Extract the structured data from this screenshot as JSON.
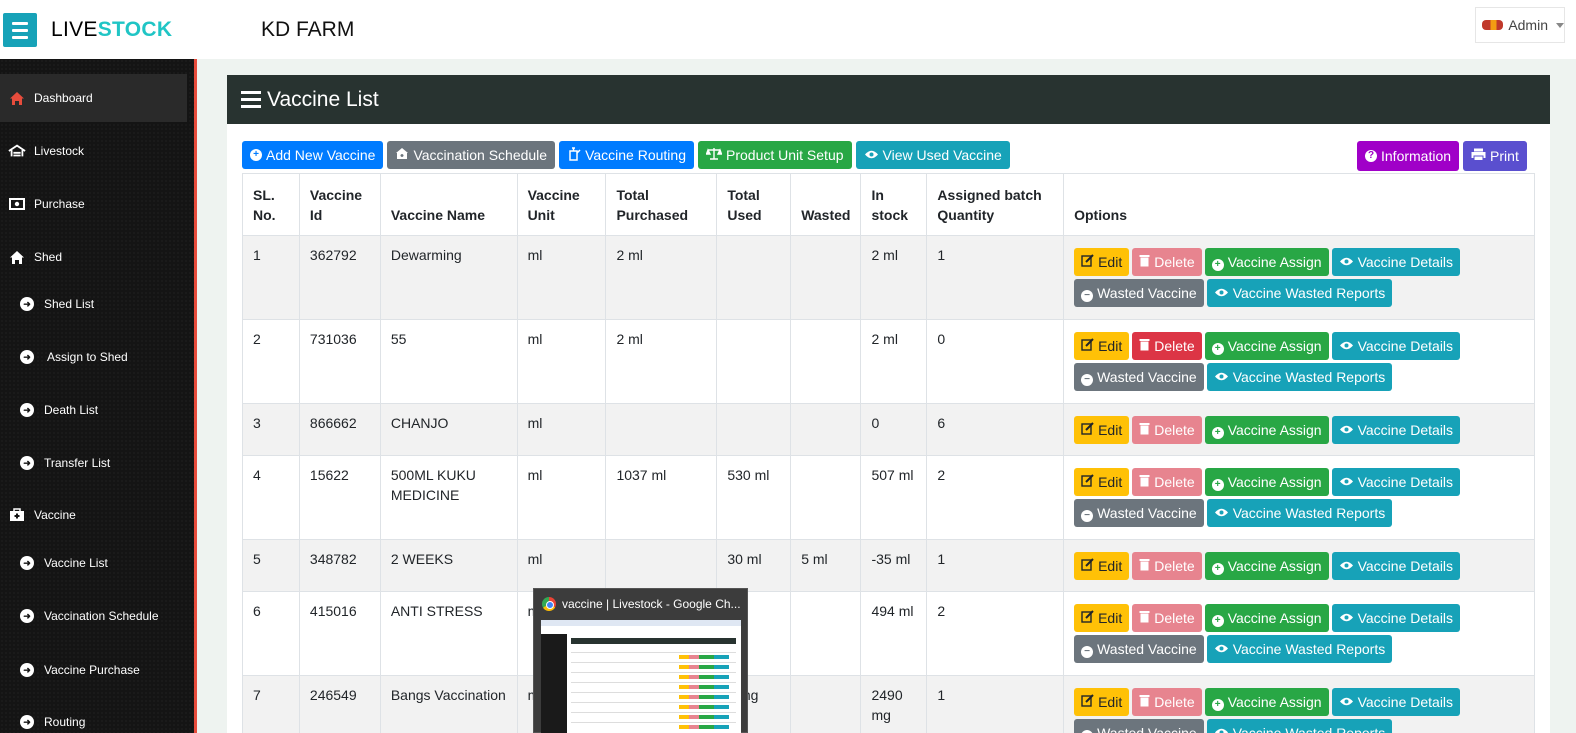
{
  "header": {
    "brand_part1": "LIVE",
    "brand_part2": "STOCK",
    "farm_name": "KD FARM",
    "user_label": "Admin"
  },
  "sidebar": {
    "items": [
      {
        "label": "Dashboard",
        "icon": "home-icon"
      },
      {
        "label": "Livestock",
        "icon": "livestock-icon"
      },
      {
        "label": "Purchase",
        "icon": "money-icon"
      },
      {
        "label": "Shed",
        "icon": "home-icon"
      },
      {
        "label": "Shed List",
        "icon": "arrow-circle-right-icon"
      },
      {
        "label": "Assign to Shed",
        "icon": "arrow-circle-right-icon"
      },
      {
        "label": "Death List",
        "icon": "arrow-circle-right-icon"
      },
      {
        "label": "Transfer List",
        "icon": "arrow-circle-right-icon"
      },
      {
        "label": "Vaccine",
        "icon": "medkit-icon"
      },
      {
        "label": "Vaccine List",
        "icon": "arrow-circle-right-icon"
      },
      {
        "label": "Vaccination Schedule",
        "icon": "arrow-circle-right-icon"
      },
      {
        "label": "Vaccine Purchase",
        "icon": "arrow-circle-right-icon"
      },
      {
        "label": "Routing",
        "icon": "arrow-circle-right-icon"
      }
    ]
  },
  "page": {
    "title": "Vaccine List"
  },
  "toolbar": {
    "add_new": "Add New Vaccine",
    "schedule": "Vaccination Schedule",
    "routing": "Vaccine Routing",
    "unit_setup": "Product Unit Setup",
    "view_used": "View Used Vaccine",
    "information": "Information",
    "print": "Print"
  },
  "table": {
    "headers": {
      "sl": "SL. No.",
      "vaccine_id": "Vaccine Id",
      "name": "Vaccine Name",
      "unit": "Vaccine Unit",
      "purchased": "Total Purchased",
      "used": "Total Used",
      "wasted": "Wasted",
      "stock": "In stock",
      "batch": "Assigned batch Quantity",
      "options": "Options"
    },
    "rows": [
      {
        "sl": "1",
        "id": "362792",
        "name": "Dewarming",
        "unit": "ml",
        "purchased": "2 ml",
        "used": "",
        "wasted": "",
        "stock": "2 ml",
        "batch": "1"
      },
      {
        "sl": "2",
        "id": "731036",
        "name": "55",
        "unit": "ml",
        "purchased": "2 ml",
        "used": "",
        "wasted": "",
        "stock": "2 ml",
        "batch": "0"
      },
      {
        "sl": "3",
        "id": "866662",
        "name": "CHANJO",
        "unit": "ml",
        "purchased": "",
        "used": "",
        "wasted": "",
        "stock": "0",
        "batch": "6"
      },
      {
        "sl": "4",
        "id": "15622",
        "name": "500ML KUKU MEDICINE",
        "unit": "ml",
        "purchased": "1037 ml",
        "used": "530 ml",
        "wasted": "",
        "stock": "507 ml",
        "batch": "2"
      },
      {
        "sl": "5",
        "id": "348782",
        "name": "2 WEEKS",
        "unit": "ml",
        "purchased": "",
        "used": "30 ml",
        "wasted": "5 ml",
        "stock": "-35 ml",
        "batch": "1"
      },
      {
        "sl": "6",
        "id": "415016",
        "name": "ANTI STRESS",
        "unit": "ml",
        "purchased": "",
        "used": "ml",
        "wasted": "",
        "stock": "494 ml",
        "batch": "2"
      },
      {
        "sl": "7",
        "id": "246549",
        "name": "Bangs Vaccination",
        "unit": "m",
        "purchased": "",
        "used": "0 mg",
        "wasted": "",
        "stock": "2490 mg",
        "batch": "1"
      }
    ],
    "options": {
      "edit": "Edit",
      "delete": "Delete",
      "assign": "Vaccine Assign",
      "details": "Vaccine Details",
      "wasted": "Wasted Vaccine",
      "wasted_reports": "Vaccine Wasted Reports"
    }
  },
  "tooltip": {
    "title": "vaccine | Livestock - Google Ch..."
  }
}
